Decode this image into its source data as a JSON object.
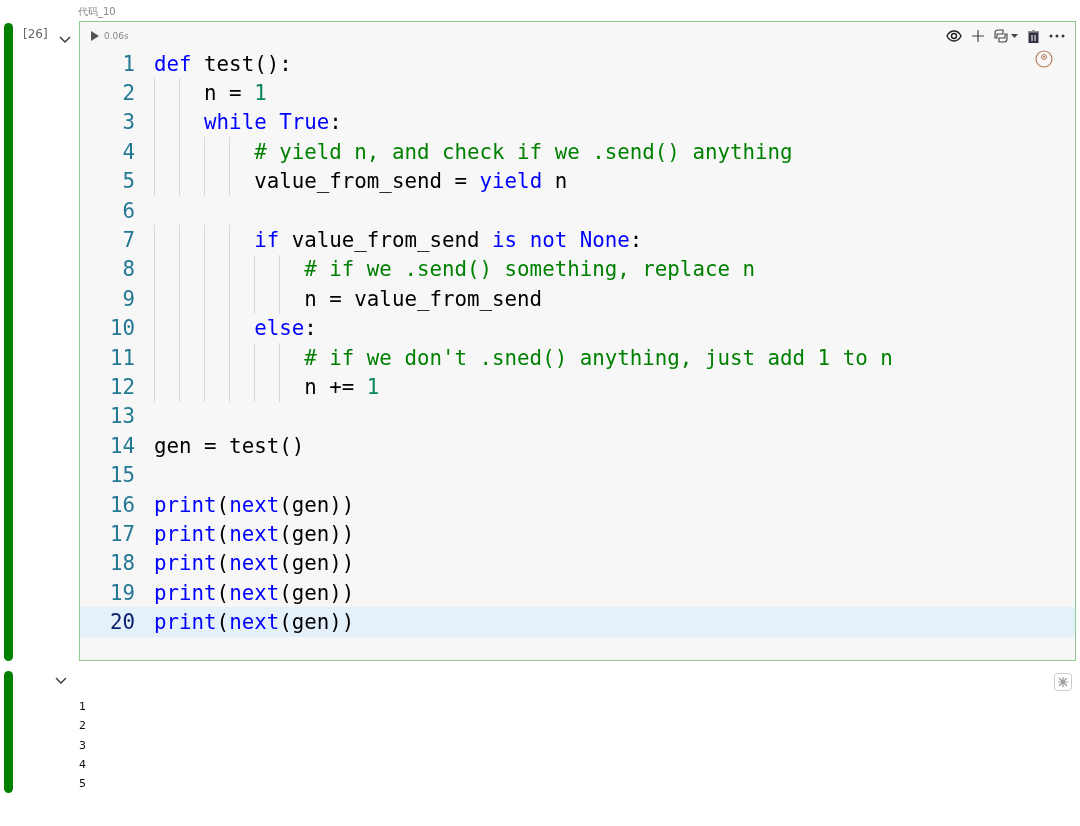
{
  "cell_caption": "代码_10",
  "code_cell": {
    "execution_count": "[26]",
    "expanded": true,
    "duration": "0.06s",
    "lines": [
      {
        "number": "1",
        "current": false,
        "tokens": [
          {
            "kind": "kw",
            "text": "def"
          },
          {
            "kind": "plain",
            "text": " test():"
          }
        ]
      },
      {
        "number": "2",
        "current": false,
        "tokens": [
          {
            "kind": "plain",
            "text": "    n = "
          },
          {
            "kind": "num",
            "text": "1"
          }
        ]
      },
      {
        "number": "3",
        "current": false,
        "tokens": [
          {
            "kind": "kw",
            "text": "    while True"
          },
          {
            "kind": "plain",
            "text": ":"
          }
        ]
      },
      {
        "number": "4",
        "current": false,
        "tokens": [
          {
            "kind": "comment",
            "text": "        # yield n, and check if we .send() anything"
          }
        ]
      },
      {
        "number": "5",
        "current": false,
        "tokens": [
          {
            "kind": "plain",
            "text": "        value_from_send = "
          },
          {
            "kind": "kw",
            "text": "yield"
          },
          {
            "kind": "plain",
            "text": " n"
          }
        ]
      },
      {
        "number": "6",
        "current": false
      },
      {
        "number": "7",
        "current": false,
        "tokens": [
          {
            "kind": "kw",
            "text": "        if"
          },
          {
            "kind": "plain",
            "text": " value_from_send "
          },
          {
            "kind": "kw",
            "text": "is not None"
          },
          {
            "kind": "plain",
            "text": ":"
          }
        ]
      },
      {
        "number": "8",
        "current": false,
        "tokens": [
          {
            "kind": "comment",
            "text": "            # if we .send() something, replace n"
          }
        ]
      },
      {
        "number": "9",
        "current": false,
        "tokens": [
          {
            "kind": "plain",
            "text": "            n = value_from_send"
          }
        ]
      },
      {
        "number": "10",
        "current": false,
        "tokens": [
          {
            "kind": "kw",
            "text": "        else"
          },
          {
            "kind": "plain",
            "text": ":"
          }
        ]
      },
      {
        "number": "11",
        "current": false,
        "tokens": [
          {
            "kind": "comment",
            "text": "            # if we don't .sned() anything, just add 1 to n"
          }
        ]
      },
      {
        "number": "12",
        "current": false,
        "tokens": [
          {
            "kind": "plain",
            "text": "            n += "
          },
          {
            "kind": "num",
            "text": "1"
          }
        ]
      },
      {
        "number": "13",
        "current": false
      },
      {
        "number": "14",
        "current": false,
        "tokens": [
          {
            "kind": "plain",
            "text": "gen = test()"
          }
        ]
      },
      {
        "number": "15",
        "current": false
      },
      {
        "number": "16",
        "current": false,
        "tokens": [
          {
            "kind": "kw",
            "text": "print"
          },
          {
            "kind": "plain",
            "text": "("
          },
          {
            "kind": "kw",
            "text": "next"
          },
          {
            "kind": "plain",
            "text": "(gen))"
          }
        ]
      },
      {
        "number": "17",
        "current": false,
        "tokens": [
          {
            "kind": "kw",
            "text": "print"
          },
          {
            "kind": "plain",
            "text": "("
          },
          {
            "kind": "kw",
            "text": "next"
          },
          {
            "kind": "plain",
            "text": "(gen))"
          }
        ]
      },
      {
        "number": "18",
        "current": false,
        "tokens": [
          {
            "kind": "kw",
            "text": "print"
          },
          {
            "kind": "plain",
            "text": "("
          },
          {
            "kind": "kw",
            "text": "next"
          },
          {
            "kind": "plain",
            "text": "(gen))"
          }
        ]
      },
      {
        "number": "19",
        "current": false,
        "tokens": [
          {
            "kind": "kw",
            "text": "print"
          },
          {
            "kind": "plain",
            "text": "("
          },
          {
            "kind": "kw",
            "text": "next"
          },
          {
            "kind": "plain",
            "text": "(gen))"
          }
        ]
      },
      {
        "number": "20",
        "current": true,
        "tokens": [
          {
            "kind": "kw",
            "text": "print"
          },
          {
            "kind": "plain",
            "text": "("
          },
          {
            "kind": "kw",
            "text": "next"
          },
          {
            "kind": "plain",
            "text": "(gen))"
          }
        ]
      }
    ]
  },
  "output": {
    "expanded": true,
    "lines": [
      "1",
      "2",
      "3",
      "4",
      "5"
    ]
  }
}
